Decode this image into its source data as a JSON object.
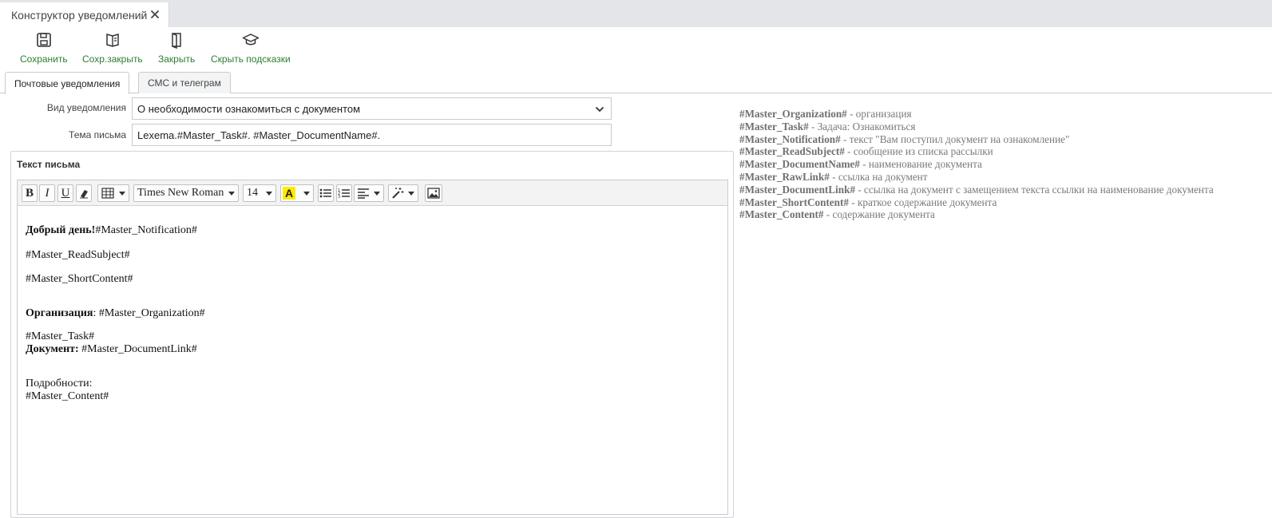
{
  "document_tab": {
    "title": "Конструктор уведомлений"
  },
  "toolbar": {
    "save": "Сохранить",
    "save_close": "Сохр.закрыть",
    "close": "Закрыть",
    "hide_hints": "Скрыть подсказки"
  },
  "tabs": [
    {
      "label": "Почтовые уведомления",
      "active": true
    },
    {
      "label": "СМС и телеграм",
      "active": false
    }
  ],
  "form": {
    "type_label": "Вид уведомления",
    "type_value": "О необходимости ознакомиться с документом",
    "subject_label": "Тема письма",
    "subject_value": "Lexema.#Master_Task#. #Master_DocumentName#."
  },
  "body_section": {
    "title": "Текст письма"
  },
  "editor_toolbar": {
    "bold": "B",
    "italic": "I",
    "underline": "U",
    "font_family": "Times New Roman",
    "font_size": "14",
    "highlight": "A"
  },
  "editor_content": {
    "l1_bold": "Добрый день!",
    "l1_rest": "#Master_Notification#",
    "l2": "#Master_ReadSubject#",
    "l3": "#Master_ShortContent#",
    "l4_bold": "Организация",
    "l4_rest": ": #Master_Organization#",
    "l5": "#Master_Task#",
    "l6_bold": "Документ:",
    "l6_rest": " #Master_DocumentLink#",
    "l7": "Подробности:",
    "l8": "#Master_Content#"
  },
  "hints": [
    {
      "key": "#Master_Organization#",
      "desc": " - организация"
    },
    {
      "key": "#Master_Task#",
      "desc": " - Задача: Ознакомиться"
    },
    {
      "key": "#Master_Notification#",
      "desc": " - текст \"Вам поступил документ на ознакомление\""
    },
    {
      "key": "#Master_ReadSubject#",
      "desc": " - сообщение из списка рассылки"
    },
    {
      "key": "#Master_DocumentName#",
      "desc": " - наименование документа"
    },
    {
      "key": "#Master_RawLink#",
      "desc": " - ссылка на документ"
    },
    {
      "key": "#Master_DocumentLink#",
      "desc": " - ссылка на документ с замещением текста ссылки на наименование документа"
    },
    {
      "key": "#Master_ShortContent#",
      "desc": " - краткое содержание документа"
    },
    {
      "key": "#Master_Content#",
      "desc": " - содержание документа"
    }
  ],
  "colors": {
    "accent_green": "#2e7d32",
    "highlight_yellow": "#ffeb00"
  }
}
